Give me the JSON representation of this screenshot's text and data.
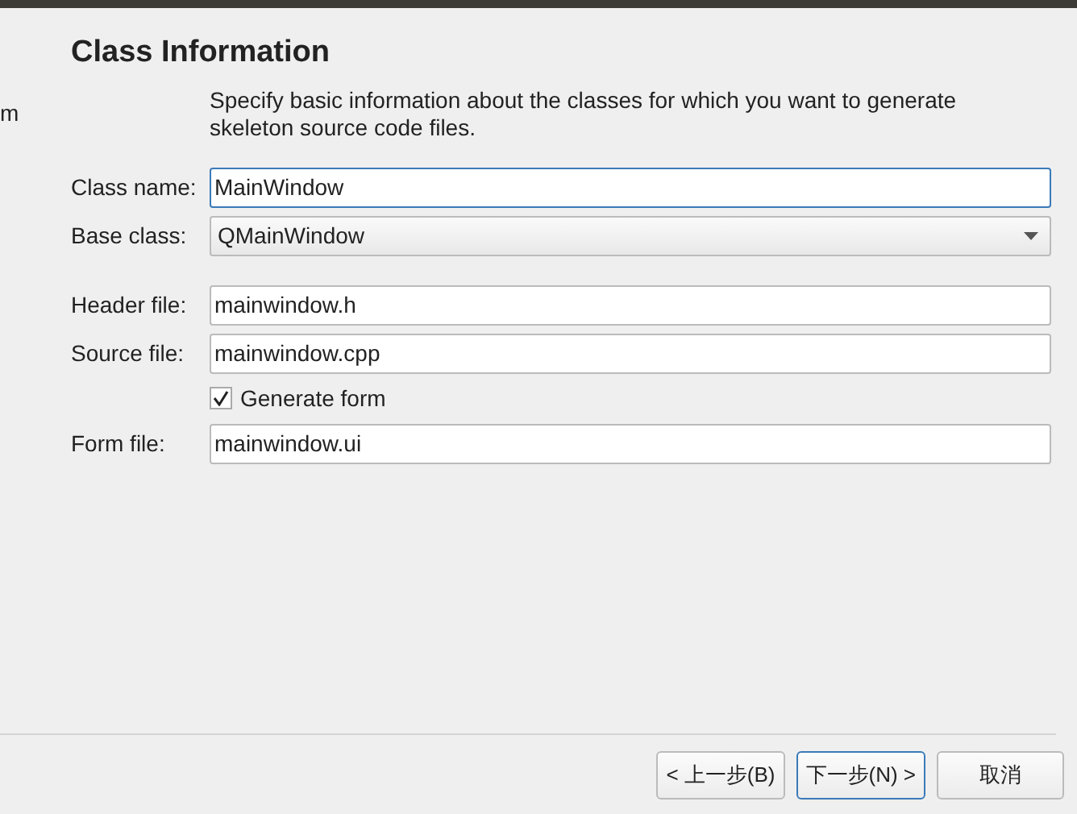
{
  "sidebar": {
    "visible_text": "m"
  },
  "page": {
    "title": "Class Information",
    "description": "Specify basic information about the classes for which you want to generate skeleton source code files."
  },
  "fields": [
    {
      "kind": "input",
      "label": "Class name:",
      "value": "MainWindow",
      "focused": true
    },
    {
      "kind": "combo",
      "label": "Base class:",
      "value": "QMainWindow",
      "focused": false
    },
    {
      "kind": "spacer"
    },
    {
      "kind": "input",
      "label": "Header file:",
      "value": "mainwindow.h",
      "focused": false
    },
    {
      "kind": "input",
      "label": "Source file:",
      "value": "mainwindow.cpp",
      "focused": false
    },
    {
      "kind": "checkbox",
      "label": "Generate form",
      "checked": true
    },
    {
      "kind": "input",
      "label": "Form file:",
      "value": "mainwindow.ui",
      "focused": false
    }
  ],
  "buttons": [
    {
      "label": "< 上一步(B)",
      "default": false
    },
    {
      "label": "下一步(N) >",
      "default": true
    },
    {
      "label": "取消",
      "default": false
    }
  ]
}
